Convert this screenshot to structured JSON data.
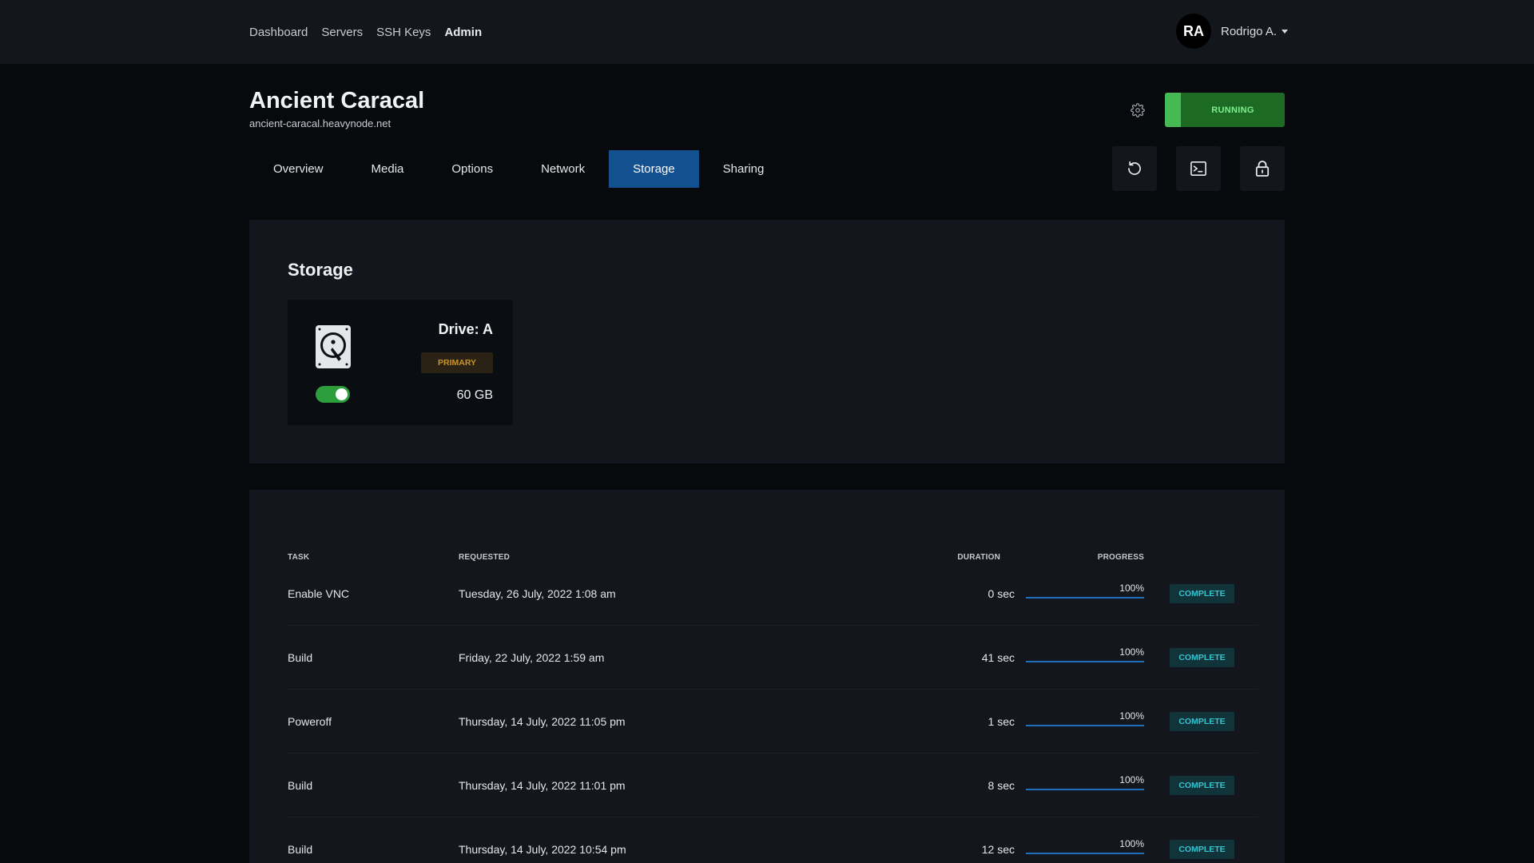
{
  "nav": {
    "links": [
      "Dashboard",
      "Servers",
      "SSH Keys",
      "Admin"
    ]
  },
  "user": {
    "initials": "RA",
    "name": "Rodrigo A."
  },
  "server": {
    "name": "Ancient Caracal",
    "host": "ancient-caracal.heavynode.net",
    "status": "RUNNING"
  },
  "tabs": [
    "Overview",
    "Media",
    "Options",
    "Network",
    "Storage",
    "Sharing"
  ],
  "active_tab": "Storage",
  "storage": {
    "title": "Storage",
    "drive": {
      "name": "Drive: A",
      "badge": "PRIMARY",
      "size": "60 GB",
      "enabled": true
    }
  },
  "tasks": {
    "headers": {
      "task": "TASK",
      "requested": "REQUESTED",
      "duration": "DURATION",
      "progress": "PROGRESS"
    },
    "rows": [
      {
        "task": "Enable VNC",
        "requested": "Tuesday, 26 July, 2022 1:08 am",
        "duration": "0 sec",
        "progress": "100%",
        "status": "COMPLETE"
      },
      {
        "task": "Build",
        "requested": "Friday, 22 July, 2022 1:59 am",
        "duration": "41 sec",
        "progress": "100%",
        "status": "COMPLETE"
      },
      {
        "task": "Poweroff",
        "requested": "Thursday, 14 July, 2022 11:05 pm",
        "duration": "1 sec",
        "progress": "100%",
        "status": "COMPLETE"
      },
      {
        "task": "Build",
        "requested": "Thursday, 14 July, 2022 11:01 pm",
        "duration": "8 sec",
        "progress": "100%",
        "status": "COMPLETE"
      },
      {
        "task": "Build",
        "requested": "Thursday, 14 July, 2022 10:54 pm",
        "duration": "12 sec",
        "progress": "100%",
        "status": "COMPLETE"
      }
    ]
  },
  "colors": {
    "accent": "#135090",
    "running": "#1c6a24",
    "primary_badge": "#c9942a",
    "complete": "#38c3d0"
  },
  "icons": {
    "settings": "gear-icon",
    "restart": "restart-icon",
    "console": "terminal-icon",
    "lock": "lock-icon",
    "drive": "hard-drive-icon"
  }
}
